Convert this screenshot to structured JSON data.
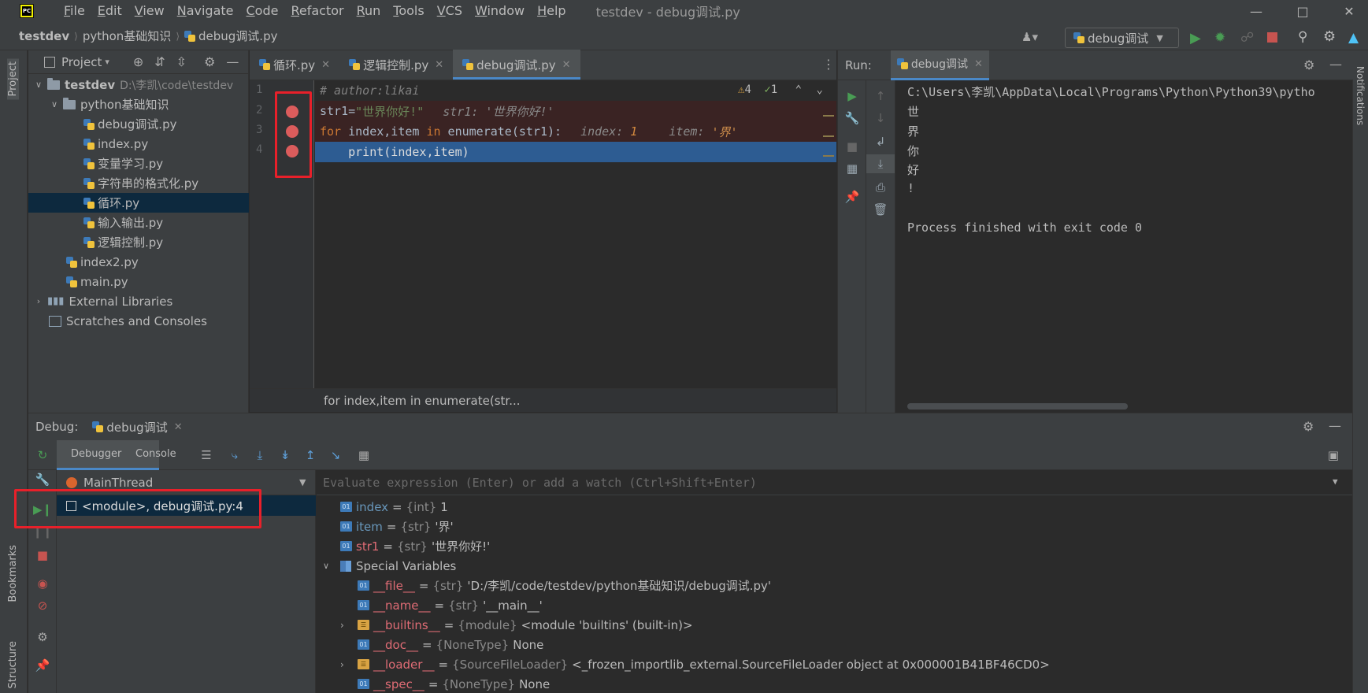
{
  "menu": {
    "items": [
      "File",
      "Edit",
      "View",
      "Navigate",
      "Code",
      "Refactor",
      "Run",
      "Tools",
      "VCS",
      "Window",
      "Help"
    ],
    "window_title": "testdev - debug调试.py"
  },
  "breadcrumb": {
    "project": "testdev",
    "folder": "python基础知识",
    "file": "debug调试.py"
  },
  "run_config": {
    "label": "debug调试"
  },
  "sidebar_left": {
    "project_tab": "Project",
    "bookmarks_tab": "Bookmarks",
    "structure_tab": "Structure"
  },
  "sidebar_right": {
    "notifications_tab": "Notifications"
  },
  "project": {
    "title": "Project",
    "tree": [
      {
        "label": "testdev",
        "path": "D:\\李凯\\code\\testdev"
      },
      {
        "label": "python基础知识"
      },
      {
        "label": "debug调试.py"
      },
      {
        "label": "index.py"
      },
      {
        "label": "变量学习.py"
      },
      {
        "label": "字符串的格式化.py"
      },
      {
        "label": "循环.py"
      },
      {
        "label": "输入输出.py"
      },
      {
        "label": "逻辑控制.py"
      },
      {
        "label": "index2.py"
      },
      {
        "label": "main.py"
      },
      {
        "label": "External Libraries"
      },
      {
        "label": "Scratches and Consoles"
      }
    ]
  },
  "editor": {
    "tabs": [
      "循环.py",
      "逻辑控制.py",
      "debug调试.py"
    ],
    "line_numbers": [
      "1",
      "2",
      "3",
      "4"
    ],
    "inspections": {
      "warnings": "4",
      "weak_warnings": "1"
    },
    "lines": {
      "l1": "# author:likai",
      "l2_code": "str1=",
      "l2_str": "\"世界你好!\"",
      "l2_inline": "str1: '世界你好!'",
      "l3_kw_for": "for",
      "l3_mid": " index,item ",
      "l3_kw_in": "in",
      "l3_end": " enumerate(str1):",
      "l3_inline_idx": "index: ",
      "l3_inline_idx_val": "1",
      "l3_inline_item": "item: ",
      "l3_inline_item_val": "'界'",
      "l4": "    print(index,item)"
    },
    "status": "for index,item in enumerate(str..."
  },
  "run": {
    "title": "Run:",
    "tab": "debug调试",
    "console": [
      "C:\\Users\\李凯\\AppData\\Local\\Programs\\Python\\Python39\\pytho",
      "世",
      "界",
      "你",
      "好",
      "!",
      "",
      "Process finished with exit code 0"
    ]
  },
  "debug": {
    "title": "Debug:",
    "tab": "debug调试",
    "subtabs": {
      "debugger": "Debugger",
      "console": "Console"
    },
    "thread": "MainThread",
    "frame": "<module>, debug调试.py:4",
    "eval_placeholder": "Evaluate expression (Enter) or add a watch (Ctrl+Shift+Enter)",
    "variables": [
      {
        "name": "index",
        "type": "{int}",
        "value": "1"
      },
      {
        "name": "item",
        "type": "{str}",
        "value": "'界'"
      },
      {
        "name": "str1",
        "type": "{str}",
        "value": "'世界你好!'"
      },
      {
        "name": "Special Variables",
        "type": "",
        "value": ""
      },
      {
        "name": "__file__",
        "type": "{str}",
        "value": "'D:/李凯/code/testdev/python基础知识/debug调试.py'"
      },
      {
        "name": "__name__",
        "type": "{str}",
        "value": "'__main__'"
      },
      {
        "name": "__builtins__",
        "type": "{module}",
        "value": "<module 'builtins' (built-in)>"
      },
      {
        "name": "__doc__",
        "type": "{NoneType}",
        "value": "None"
      },
      {
        "name": "__loader__",
        "type": "{SourceFileLoader}",
        "value": "<_frozen_importlib_external.SourceFileLoader object at 0x000001B41BF46CD0>"
      },
      {
        "name": "__spec__",
        "type": "{NoneType}",
        "value": "None"
      }
    ]
  },
  "colors": {
    "accent": "#4a88c7",
    "breakpoint": "#db5c5c",
    "run_green": "#499c54",
    "stop_red": "#c75450",
    "annotation_red": "#e8202a"
  }
}
